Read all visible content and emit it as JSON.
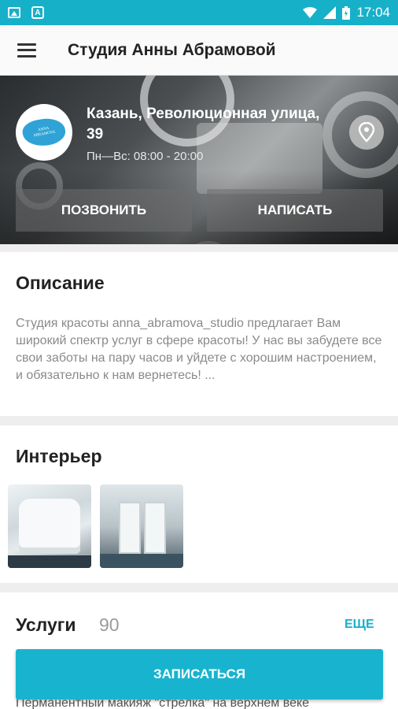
{
  "status_bar": {
    "time": "17:04"
  },
  "app_bar": {
    "title": "Студия Анны Абрамовой"
  },
  "hero": {
    "address": "Казань, Революционная улица, 39",
    "hours": "Пн—Вс: 08:00 - 20:00",
    "call_label": "ПОЗВОНИТЬ",
    "write_label": "НАПИСАТЬ"
  },
  "description": {
    "title": "Описание",
    "text": "Студия красоты anna_abramova_studio предлагает Вам широкий спектр услуг в сфере красоты! У нас вы забудете все свои заботы на пару часов и уйдете с хорошим настроением, и обязательно к нам вернетесь! ..."
  },
  "interior": {
    "title": "Интерьер"
  },
  "services": {
    "title": "Услуги",
    "count": "90",
    "more_label": "ЕЩЕ",
    "first_item": "Перманентный макияж \"стрелка\" на верхнем веке"
  },
  "book_button": {
    "label": "ЗАПИСАТЬСЯ"
  },
  "colors": {
    "accent": "#17b0c9"
  }
}
